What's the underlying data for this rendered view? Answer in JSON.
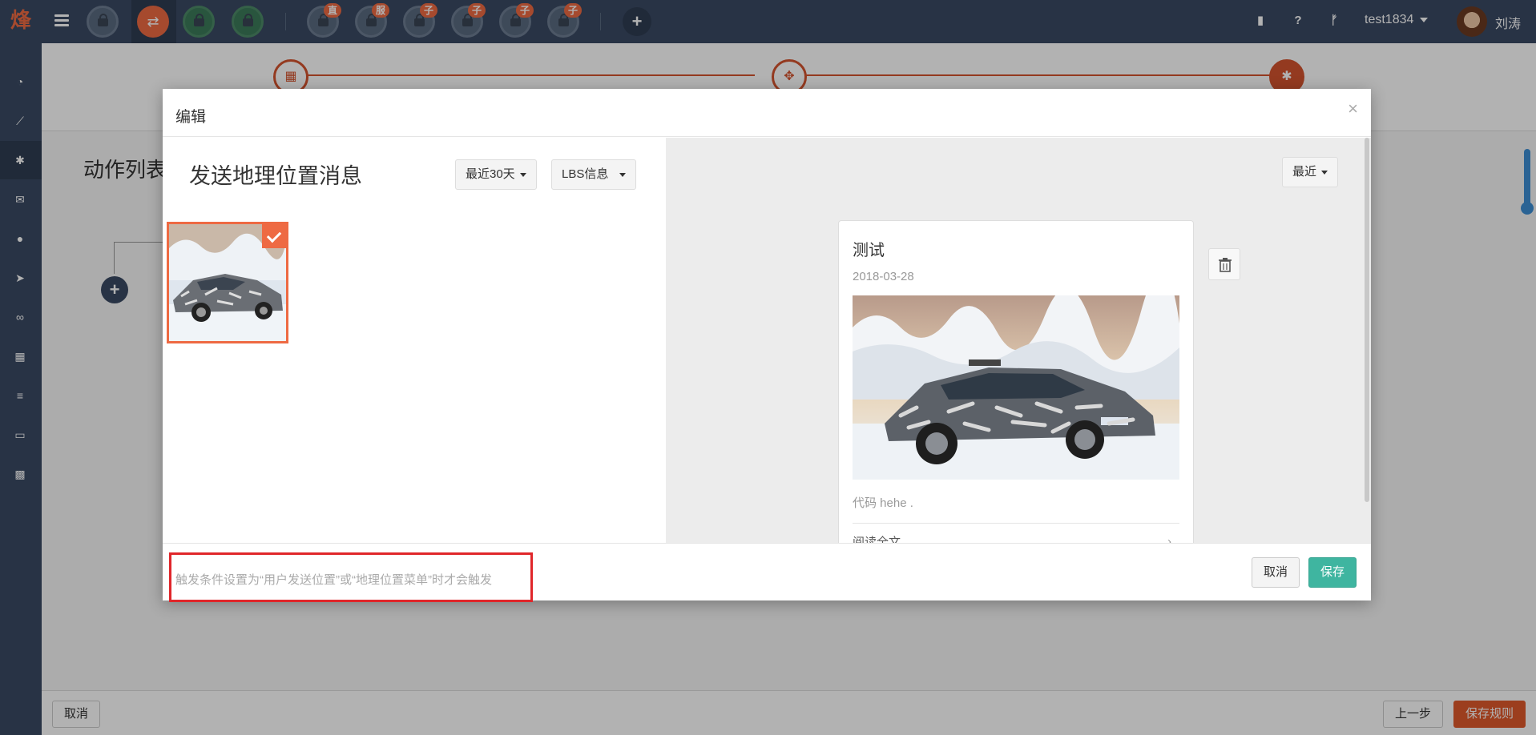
{
  "topbar": {
    "logo": "烽",
    "accounts": [
      {
        "badge": ""
      },
      {
        "badge": ""
      },
      {
        "badge": ""
      },
      {
        "badge": ""
      }
    ],
    "tagged_accounts": [
      {
        "badge": "直"
      },
      {
        "badge": "服"
      },
      {
        "badge": "子"
      },
      {
        "badge": "子"
      },
      {
        "badge": "子"
      },
      {
        "badge": "子"
      }
    ],
    "add_symbol": "+",
    "username": "test1834",
    "real_name": "刘涛"
  },
  "sidebar": {
    "icons": [
      "dashboard-icon",
      "chart-icon",
      "gear-icon",
      "envelope-icon",
      "user-icon",
      "paper-plane-icon",
      "link-icon",
      "qrcode-icon",
      "list-icon",
      "desktop-icon",
      "grid-icon"
    ]
  },
  "background": {
    "action_title": "动作列表",
    "cancel_label": "取消",
    "prev_label": "上一步",
    "save_rule_label": "保存规则"
  },
  "modal": {
    "title": "编辑",
    "close_symbol": "×",
    "pane_title": "发送地理位置消息",
    "range_dropdown": "最近30天",
    "type_dropdown": "LBS信息",
    "recent_dropdown": "最近",
    "card": {
      "title": "测试",
      "date": "2018-03-28",
      "desc": "代码 hehe .",
      "more": "阅读全文",
      "chevron": "›"
    },
    "hint": "触发条件设置为“用户发送位置”或“地理位置菜单”时才会触发",
    "cancel_label": "取消",
    "save_label": "保存"
  }
}
